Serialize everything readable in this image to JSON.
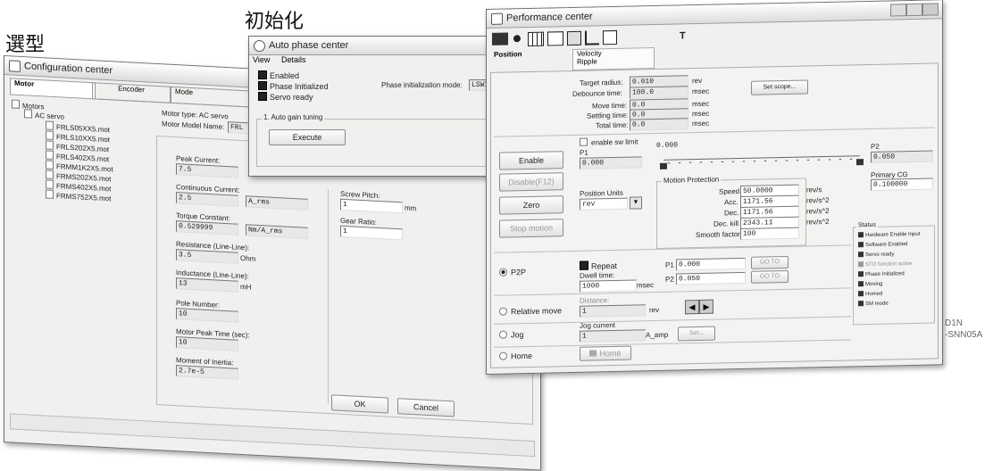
{
  "captions": {
    "selection": "選型",
    "initialization": "初始化",
    "model_code": "D1N\n-SNN05A"
  },
  "config": {
    "title": "Configuration center",
    "tabs": [
      "Motor",
      "Encoder",
      "Mode"
    ],
    "tree_root": "Motors",
    "tree_group": "AC servo",
    "tree_items": [
      "FRLS05XX5.mot",
      "FRLS10XX5.mot",
      "FRLS202X5.mot",
      "FRLS402X5.mot",
      "FRMM1K2X5.mot",
      "FRMS202X5.mot",
      "FRMS402X5.mot",
      "FRMS752X5.mot"
    ],
    "motor_type": "Motor type: AC servo",
    "motor_model_label": "Motor Model Name:",
    "motor_model_value": "FRL",
    "peak_current_label": "Peak Current:",
    "peak_current": "7.5",
    "cont_current_label": "Continuous Current:",
    "cont_current": "2.5",
    "cont_current_unit": "A_rms",
    "torque_label": "Torque Constant:",
    "torque": "0.529999",
    "torque_unit": "Nm/A_rms",
    "resistance_label": "Resistance (Line-Line):",
    "resistance": "3.5",
    "resistance_unit": "Ohm",
    "inductance_label": "Inductance (Line-Line):",
    "inductance": "13",
    "inductance_unit": "mH",
    "pole_label": "Pole Number:",
    "pole": "10",
    "peak_time_label": "Motor Peak Time (sec):",
    "peak_time": "10",
    "inertia_label": "Moment of Inertia:",
    "inertia": "2.7e-5",
    "screw_label": "Screw Pitch:",
    "screw": "1",
    "screw_unit": "mm",
    "gear_label": "Gear Ratio:",
    "gear": "1",
    "ok": "OK",
    "cancel": "Cancel"
  },
  "auto_phase": {
    "title": "Auto phase center",
    "menu": [
      "View",
      "Details"
    ],
    "checks": [
      "Enabled",
      "Phase Initialized",
      "Servo ready"
    ],
    "mode_label": "Phase initialization mode:",
    "mode_value": "LSWII",
    "group_label": "1. Auto gain tuning",
    "execute": "Execute"
  },
  "perf": {
    "title": "Performance center",
    "tabs": [
      "Position",
      "Velocity\nRipple"
    ],
    "cursor_label": "T",
    "target_radius_label": "Target radius:",
    "target_radius": "0.010",
    "target_radius_unit": "rev",
    "debounce_label": "Debounce time:",
    "debounce": "100.0",
    "debounce_unit": "msec",
    "move_time_label": "Move time:",
    "move_time": "0.0",
    "settling_label": "Settling time:",
    "settling": "0.0",
    "total_label": "Total time:",
    "total": "0.0",
    "msec": "msec",
    "set_scope": "Set scope...",
    "enable_sw_limit": "enable sw limit",
    "slider_value": "0.000",
    "p1_label": "P1",
    "p1_value": "0.000",
    "p2_label": "P2",
    "p2_value": "0.050",
    "primary_cg_label": "Primary CG",
    "primary_cg": "0.100000",
    "enable": "Enable",
    "disable": "Disable(F12)",
    "zero": "Zero",
    "stop": "Stop motion",
    "position_units_label": "Position Units",
    "position_units": "rev",
    "motion_protection": "Motion Protection",
    "speed_label": "Speed",
    "speed": "50.0000",
    "speed_unit": "rev/s",
    "acc_label": "Acc.",
    "acc": "1171.56",
    "acc_unit": "rev/s^2",
    "dec_label": "Dec.",
    "dec": "1171.56",
    "dec_unit": "rev/s^2",
    "deckill_label": "Dec. kill",
    "deckill": "2343.11",
    "deckill_unit": "rev/s^2",
    "smooth_label": "Smooth factor",
    "smooth": "100",
    "status_label": "Status",
    "status_items": [
      "Hardware Enable Input",
      "Software Enabled",
      "Servo ready",
      "STO function active",
      "Phase Initialized",
      "Moving",
      "Homed",
      "SM mode"
    ],
    "p2p": "P2P",
    "repeat": "Repeat",
    "dwell_label": "Dwell time:",
    "dwell": "1000",
    "dwell_unit": "msec",
    "p1_row_label": "P1",
    "p1_row": "0.000",
    "p2_row_label": "P2",
    "p2_row": "0.050",
    "goto": "GO TO",
    "relative": "Relative move",
    "distance_label": "Distance:",
    "distance": "1",
    "distance_unit": "rev",
    "jog": "Jog",
    "jog_current_label": "Jog current",
    "jog_current": "1",
    "jog_unit": "A_amp",
    "set": "Set...",
    "home": "Home",
    "home_btn": "Home"
  }
}
